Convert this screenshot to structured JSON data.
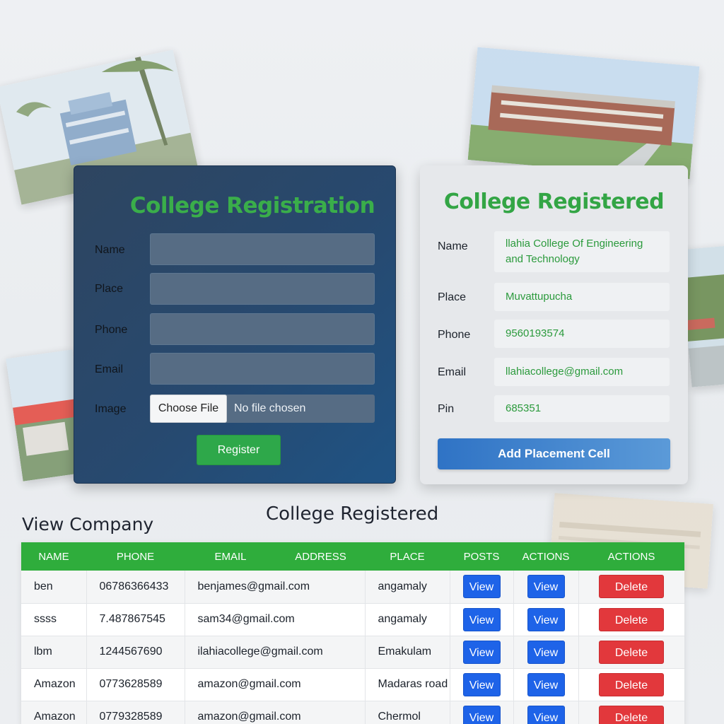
{
  "registration_form": {
    "title": "College Registration",
    "fields": {
      "name_label": "Name",
      "place_label": "Place",
      "phone_label": "Phone",
      "email_label": "Email",
      "image_label": "Image"
    },
    "file_button": "Choose File",
    "file_status": "No file chosen",
    "register_button": "Register"
  },
  "registered_card": {
    "title": "College Registered",
    "name_label": "Name",
    "name_value": "llahia College Of Engineering and Technology",
    "place_label": "Place",
    "place_value": "Muvattupucha",
    "phone_label": "Phone",
    "phone_value": "9560193574",
    "email_label": "Email",
    "email_value": "llahiacollege@gmail.com",
    "pin_label": "Pin",
    "pin_value": "685351",
    "placement_button": "Add Placement Cell"
  },
  "section_titles": {
    "view_company": "View Company",
    "college_registered": "College Registered"
  },
  "table": {
    "headers": [
      "NAME",
      "PHONE",
      "EMAIL",
      "ADDRESS",
      "PLACE",
      "POSTS",
      "ACTIONS",
      "ACTIONS"
    ],
    "view_label": "View",
    "delete_label": "Delete",
    "rows": [
      {
        "name": "ben",
        "phone": "06786366433",
        "email": "benjames@gmail.com",
        "place": "angamaly"
      },
      {
        "name": "ssss",
        "phone": "7.487867545",
        "email": "sam34@gmail.com",
        "place": "angamaly"
      },
      {
        "name": "lbm",
        "phone": "1244567690",
        "email": "ilahiacollege@gmail.com",
        "place": "Emakulam"
      },
      {
        "name": "Amazon",
        "phone": "0773628589",
        "email": "amazon@gmail.com",
        "place": "Madaras road"
      },
      {
        "name": "Amazon",
        "phone": "0779328589",
        "email": "amazon@gmail.com",
        "place": "Chermol"
      }
    ]
  },
  "colors": {
    "title_green": "#3aae4a",
    "header_green": "#2fad3c",
    "view_blue": "#1e63e8",
    "delete_red": "#e2383c",
    "form_navy": "#27496f"
  }
}
